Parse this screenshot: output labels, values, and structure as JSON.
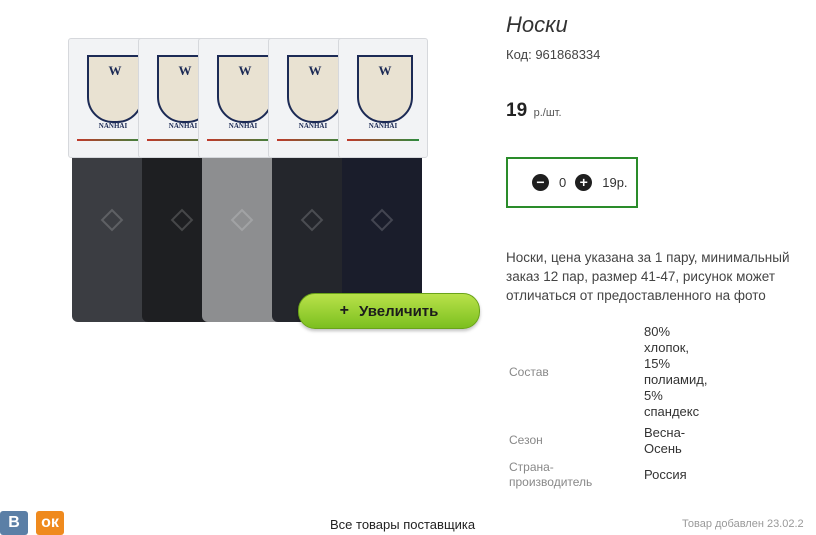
{
  "product": {
    "title": "Носки",
    "code": "Код: 961868334",
    "price": "19",
    "price_unit": "р./шт.",
    "description": "Носки, цена указана за 1 пару, минимальный заказ 12 пар, размер 41-47, рисунок может отличаться от предоставленного на фото"
  },
  "quantity": {
    "minus_icon": "minus-icon",
    "plus_icon": "plus-icon",
    "value": "0",
    "sum": "19р."
  },
  "image": {
    "zoom_label": "Увеличить",
    "zoom_plus": "+",
    "brand": "NANHAI",
    "emblem_letter": "W",
    "sock_colors": [
      "#3b3d42",
      "#1e1f22",
      "#8d8e90",
      "#24262c",
      "#1a1d2b"
    ]
  },
  "specs": [
    {
      "label": "Состав",
      "value": [
        "80%",
        "хлопок,",
        "15%",
        "полиамид,",
        "5%",
        "спандекс"
      ]
    },
    {
      "label": "Сезон",
      "value": [
        "Весна-",
        "Осень"
      ]
    },
    {
      "label": [
        "Страна-",
        "производитель"
      ],
      "value": [
        "Россия"
      ]
    }
  ],
  "footer": {
    "supplier_link": "Все товары поставщика",
    "added": "Товар добавлен 23.02.2",
    "vk": "В",
    "ok": "ок"
  },
  "colors": {
    "accent_green": "#2a8c2a",
    "zoom_button": "#8fcc2a"
  }
}
